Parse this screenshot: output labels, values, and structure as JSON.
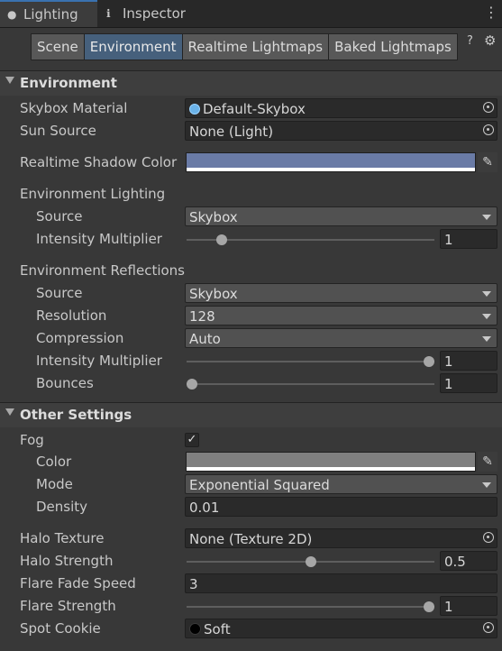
{
  "window_tabs": [
    {
      "label": "Lighting",
      "icon": "lightbulb-icon",
      "active": true
    },
    {
      "label": "Inspector",
      "icon": "info-icon",
      "active": false
    }
  ],
  "subtabs": [
    "Scene",
    "Environment",
    "Realtime Lightmaps",
    "Baked Lightmaps"
  ],
  "active_subtab": "Environment",
  "environment": {
    "header": "Environment",
    "skybox_material": {
      "label": "Skybox Material",
      "value": "Default-Skybox"
    },
    "sun_source": {
      "label": "Sun Source",
      "value": "None (Light)"
    },
    "shadow_color": {
      "label": "Realtime Shadow Color",
      "color": "#6a7ba6"
    },
    "env_lighting": {
      "label": "Environment Lighting",
      "source_label": "Source",
      "source_value": "Skybox",
      "intensity_label": "Intensity Multiplier",
      "intensity_value": "1",
      "intensity_fraction": 0.125
    },
    "env_reflections": {
      "label": "Environment Reflections",
      "source_label": "Source",
      "source_value": "Skybox",
      "resolution_label": "Resolution",
      "resolution_value": "128",
      "compression_label": "Compression",
      "compression_value": "Auto",
      "intensity_label": "Intensity Multiplier",
      "intensity_value": "1",
      "intensity_fraction": 1.0,
      "bounces_label": "Bounces",
      "bounces_value": "1",
      "bounces_fraction": 0.0
    }
  },
  "other_settings": {
    "header": "Other Settings",
    "fog": {
      "label": "Fog",
      "checked": true,
      "check_glyph": "✓"
    },
    "fog_color": {
      "label": "Color",
      "color": "#808080"
    },
    "fog_mode": {
      "label": "Mode",
      "value": "Exponential Squared"
    },
    "fog_density": {
      "label": "Density",
      "value": "0.01"
    },
    "halo_texture": {
      "label": "Halo Texture",
      "value": "None (Texture 2D)"
    },
    "halo_strength": {
      "label": "Halo Strength",
      "value": "0.5",
      "fraction": 0.5
    },
    "flare_fade_speed": {
      "label": "Flare Fade Speed",
      "value": "3"
    },
    "flare_strength": {
      "label": "Flare Strength",
      "value": "1",
      "fraction": 1.0
    },
    "spot_cookie": {
      "label": "Spot Cookie",
      "value": "Soft"
    }
  },
  "glyphs": {
    "menu": "⋮",
    "help": "?",
    "gear": "⚙",
    "eyedropper": "✎",
    "lightbulb": "●",
    "info": "ℹ"
  }
}
